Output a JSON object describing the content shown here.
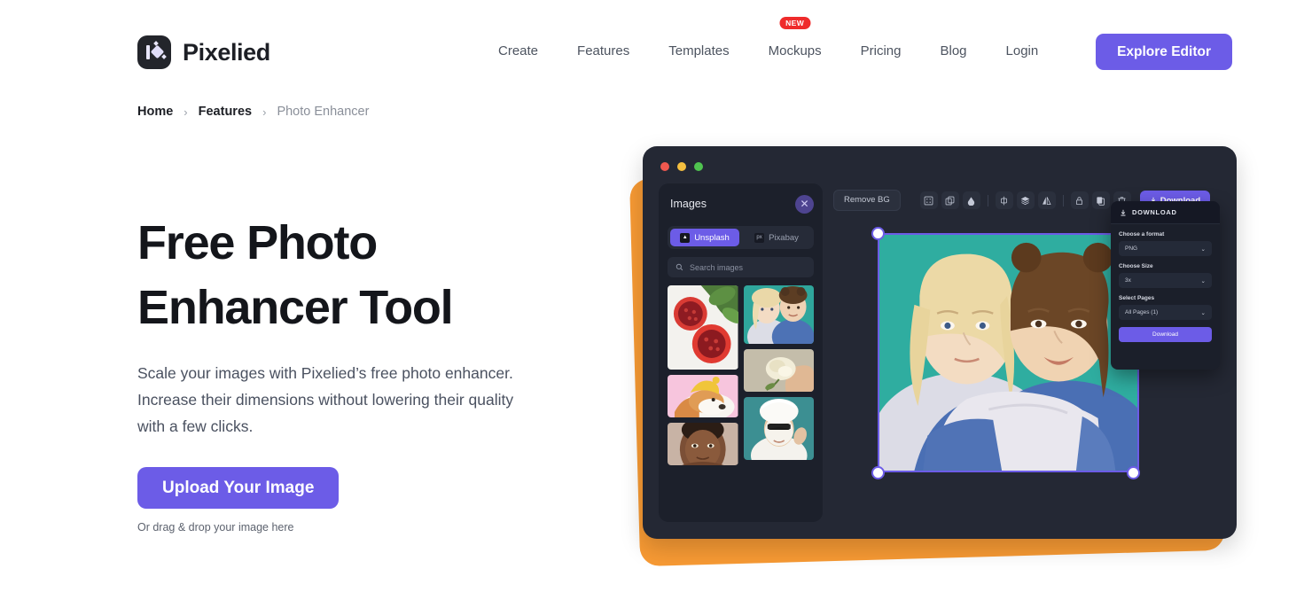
{
  "brand": {
    "name": "Pixelied",
    "logo_icon": "pixelied-logo-icon"
  },
  "nav": {
    "items": [
      {
        "label": "Create"
      },
      {
        "label": "Features"
      },
      {
        "label": "Templates"
      },
      {
        "label": "Mockups",
        "badge": "NEW"
      },
      {
        "label": "Pricing"
      },
      {
        "label": "Blog"
      },
      {
        "label": "Login"
      }
    ],
    "cta": {
      "label": "Explore Editor",
      "color": "#6c5ce7"
    }
  },
  "breadcrumb": {
    "items": [
      {
        "label": "Home"
      },
      {
        "label": "Features"
      },
      {
        "label": "Photo Enhancer"
      }
    ],
    "separator": "›"
  },
  "hero": {
    "title": "Free Photo Enhancer Tool",
    "subtitle": "Scale your images with Pixelied’s free photo enhancer. Increase their dimensions without lowering their quality with a few clicks.",
    "upload_button": "Upload Your Image",
    "drag_note": "Or drag & drop your image here"
  },
  "editor": {
    "window_dots": [
      "red",
      "yellow",
      "green"
    ],
    "accent_color": "#f79a34",
    "panel": {
      "title": "Images",
      "close_icon": "close-icon",
      "tabs": [
        {
          "label": "Unsplash",
          "active": true,
          "icon": "unsplash-icon"
        },
        {
          "label": "Pixabay",
          "active": false,
          "icon": "pixabay-icon"
        }
      ],
      "search_placeholder": "Search images",
      "search_icon": "search-icon",
      "thumbnails": [
        {
          "name": "pomegranate-thumb"
        },
        {
          "name": "two-girls-hugging-thumb"
        },
        {
          "name": "white-rose-in-hand-thumb"
        },
        {
          "name": "shiba-dog-yellow-hat-thumb"
        },
        {
          "name": "woman-portrait-thumb"
        },
        {
          "name": "woman-face-mask-towel-thumb"
        }
      ]
    },
    "toolbar": {
      "remove_bg": "Remove BG",
      "icons": [
        "position-icon",
        "duplicate-icon",
        "opacity-icon",
        "align-icon",
        "layers-icon",
        "flip-icon",
        "lock-icon",
        "copy-icon",
        "trash-icon"
      ],
      "download_button": "Download",
      "download_icon": "download-icon"
    },
    "download_panel": {
      "header": "DOWNLOAD",
      "header_icon": "download-icon",
      "format_label": "Choose a format",
      "format_value": "PNG",
      "size_label": "Choose Size",
      "size_value": "3x",
      "pages_label": "Select Pages",
      "pages_value": "All Pages (1)",
      "button": "Download"
    },
    "canvas": {
      "selected_image": "two-girls-hugging-canvas",
      "handles": 4
    }
  }
}
